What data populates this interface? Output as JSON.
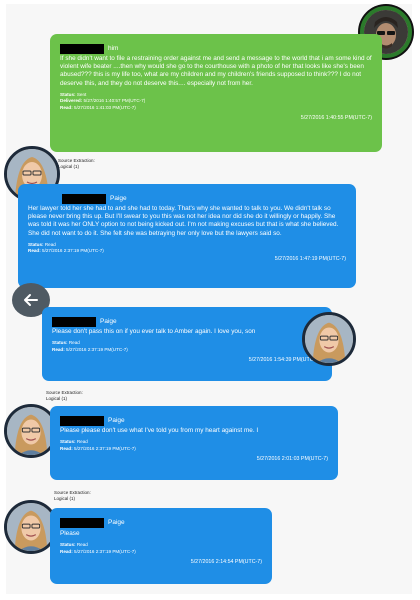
{
  "messages": [
    {
      "sender": "him",
      "text": "If she didn't want to file a restraining order against me and send a message to the world that i am some kind of violent wife beater ....then why would she go to the courthouse with a photo of her that looks like she's been abused??? this is my life too, what are my children and my children's friends supposed to think??? I do not deserve this, and they do not deserve this.... especially not from her.",
      "status_label": "Status:",
      "status": "Sent",
      "delivered_label": "Delivered:",
      "delivered": "5/27/2016 1:40:57 PM(UTC-7)",
      "read_label": "Read:",
      "read": "5/27/2016 1:41:03 PM(UTC-7)",
      "timestamp": "5/27/2016 1:40:55 PM(UTC-7)"
    },
    {
      "sender": "Paige",
      "text": "Her lawyer told her she had to and she had to today. That's why she wanted to talk to you. We didn't talk so please never bring this up. But I'll swear to you this was not her idea nor did she do it willingly or happily. She was told it was her ONLY option to not being kicked out. I'm not making excuses but that is what she believed. She did not want to do it. She felt she was betraying her only love but the lawyers said so.",
      "status_label": "Status:",
      "status": "Read",
      "read_label": "Read:",
      "read": "5/27/2016 2:37:19 PM(UTC-7)",
      "timestamp": "5/27/2016 1:47:19 PM(UTC-7)"
    },
    {
      "sender": "Paige",
      "text": "Please don't pass this on if you ever talk to Amber again. I love you, son",
      "status_label": "Status:",
      "status": "Read",
      "read_label": "Read:",
      "read": "5/27/2016 2:37:19 PM(UTC-7)",
      "timestamp": "5/27/2016 1:54:39 PM(UTC-7)"
    },
    {
      "sender": "Paige",
      "text": "Please please don't use what I've told you from my heart against me. I",
      "status_label": "Status:",
      "status": "Read",
      "read_label": "Read:",
      "read": "5/27/2016 2:37:19 PM(UTC-7)",
      "timestamp": "5/27/2016 2:01:03 PM(UTC-7)"
    },
    {
      "sender": "Paige",
      "text": "Please",
      "status_label": "Status:",
      "status": "Read",
      "read_label": "Read:",
      "read": "5/27/2016 2:37:19 PM(UTC-7)",
      "timestamp": "5/27/2016 2:14:54 PM(UTC-7)"
    }
  ],
  "source_labels": {
    "top_partial": "Source Extraction:",
    "top_partial_2": "Logical (1)",
    "mid_1": "Source Extraction:",
    "mid_2": "Logical (1)",
    "low_1": "Source Extraction:",
    "low_2": "Logical (1)"
  },
  "colors": {
    "green": "#6cc24a",
    "blue": "#1f8ee6",
    "back_button": "#4f5a63"
  },
  "icons": {
    "back": "arrow-left-icon"
  }
}
